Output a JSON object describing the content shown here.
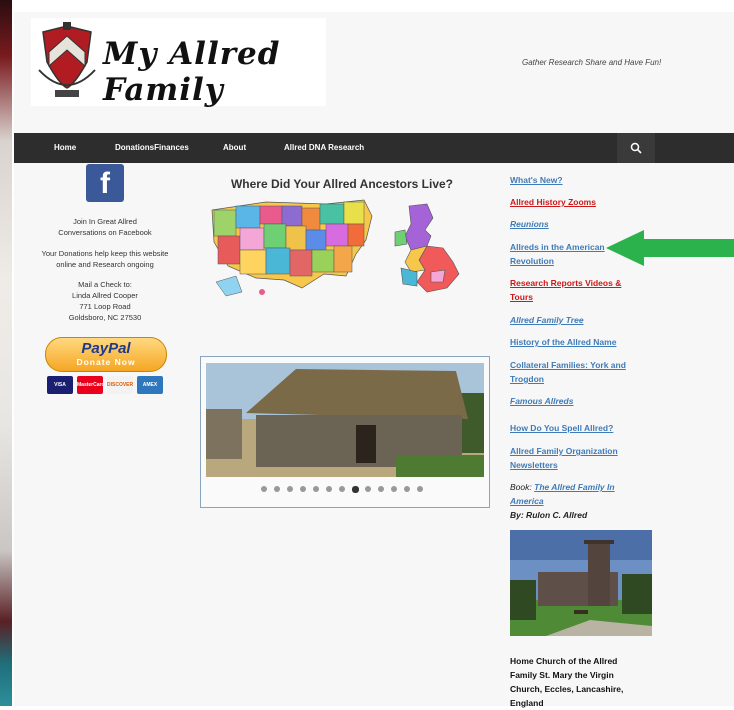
{
  "header": {
    "logo_text": "My Allred Family",
    "tagline": "Gather Research Share and Have Fun!"
  },
  "nav": {
    "items": [
      "Home",
      "DonationsFinances",
      "About",
      "Allred DNA Research"
    ],
    "search_icon": "search-icon"
  },
  "left": {
    "facebook_icon": "facebook-icon",
    "join_line1": "Join In Great Allred",
    "join_line2": "Conversations on Facebook",
    "donate_line1": "Your Donations help keep this website",
    "donate_line2": "online and Research ongoing",
    "mail_heading": "Mail a Check to:",
    "mail_name": "Linda Allred Cooper",
    "mail_street": "771 Loop Road",
    "mail_city": "Goldsboro, NC 27530",
    "paypal_brand": "PayPal",
    "paypal_action": "Donate Now",
    "cards": [
      "VISA",
      "MasterCard",
      "DISCOVER",
      "AMEX"
    ]
  },
  "center": {
    "map_title": "Where Did Your Allred Ancestors Live?",
    "slider_total": 13,
    "slider_active": 8
  },
  "right": {
    "links": [
      {
        "text": "What's New?",
        "color": "#3f7bb8",
        "italic": false
      },
      {
        "text": "Allred History Zooms",
        "color": "#cc1818",
        "italic": false
      },
      {
        "text": "Reunions",
        "color": "#3f7bb8",
        "italic": true
      },
      {
        "text": "Allreds in the American Revolution",
        "color": "#3f7bb8",
        "italic": false
      },
      {
        "text": "Research Reports Videos & Tours",
        "color": "#cc1818",
        "italic": false
      },
      {
        "text": "Allred Family Tree",
        "color": "#3f7bb8",
        "italic": true
      },
      {
        "text": "History of the Allred Name",
        "color": "#3f7bb8",
        "italic": false
      },
      {
        "text": "Collateral Families:  York and Trogdon",
        "color": "#3f7bb8",
        "italic": false
      },
      {
        "text": "Famous Allreds",
        "color": "#3f7bb8",
        "italic": true
      },
      {
        "text": "How Do You Spell Allred?",
        "color": "#3f7bb8",
        "italic": false
      },
      {
        "text": "Allred Family Organization Newsletters",
        "color": "#3f7bb8",
        "italic": false
      }
    ],
    "book_prefix": "Book:",
    "book_title": "The Allred Family In America",
    "book_author": "By:  Rulon C. Allred",
    "church_caption": "Home Church of the Allred Family St. Mary the Virgin Church, Eccles, Lancashire, England"
  },
  "colors": {
    "nav_bg": "#2d2d2d",
    "link_blue": "#3f7bb8",
    "link_red": "#cc1818",
    "arrow_green": "#2bb24c"
  }
}
